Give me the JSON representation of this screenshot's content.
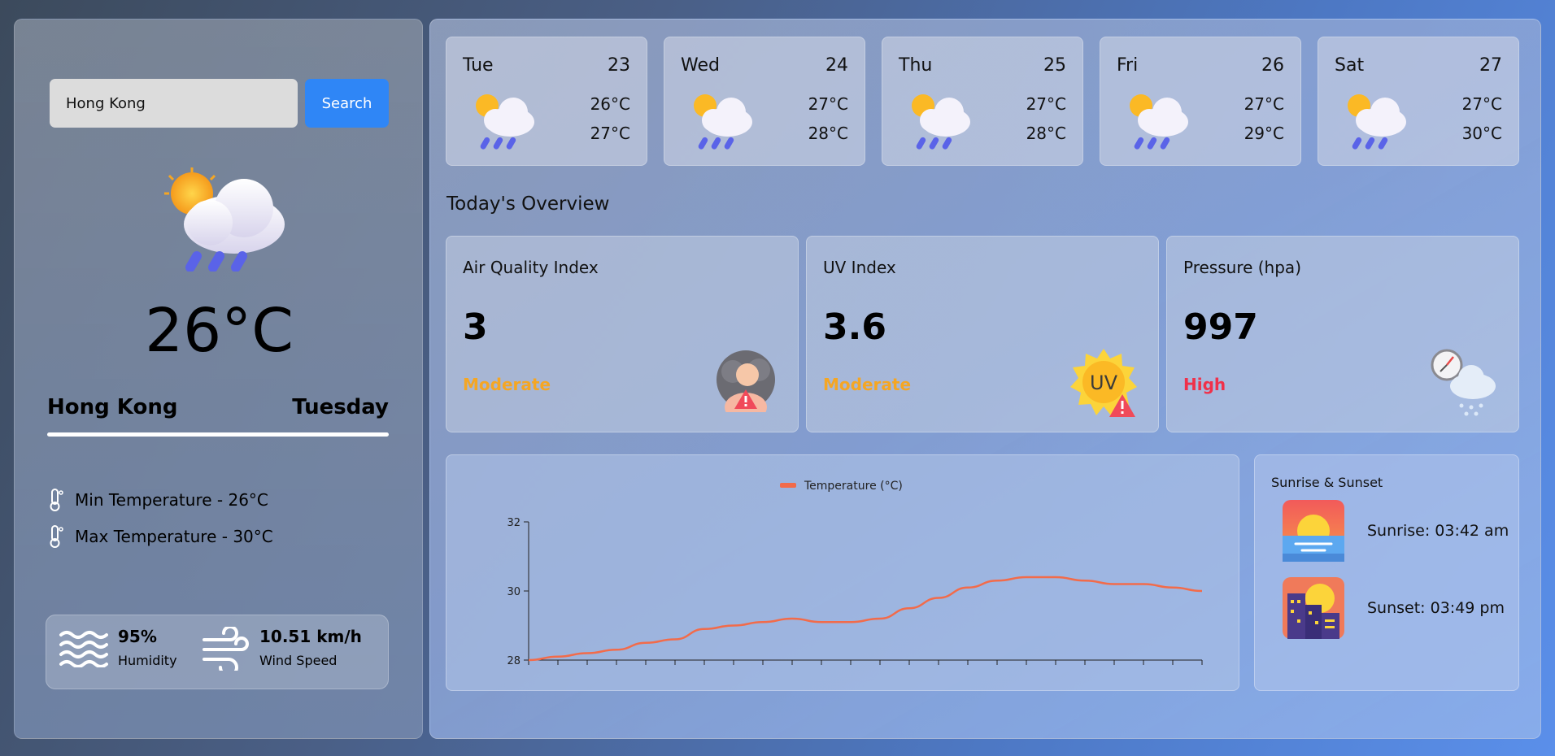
{
  "search": {
    "value": "Hong Kong",
    "button_label": "Search"
  },
  "current": {
    "temperature": "26°C",
    "location": "Hong Kong",
    "day": "Tuesday",
    "min_temp": "Min Temperature - 26°C",
    "max_temp": "Max Temperature - 30°C",
    "humidity_value": "95%",
    "humidity_label": "Humidity",
    "wind_value": "10.51 km/h",
    "wind_label": "Wind Speed",
    "icon": "sun-cloud-rain-icon"
  },
  "forecast": [
    {
      "day": "Tue",
      "date": "23",
      "min": "26°C",
      "max": "27°C"
    },
    {
      "day": "Wed",
      "date": "24",
      "min": "27°C",
      "max": "28°C"
    },
    {
      "day": "Thu",
      "date": "25",
      "min": "27°C",
      "max": "28°C"
    },
    {
      "day": "Fri",
      "date": "26",
      "min": "27°C",
      "max": "29°C"
    },
    {
      "day": "Sat",
      "date": "27",
      "min": "27°C",
      "max": "30°C"
    }
  ],
  "overview": {
    "title": "Today's Overview",
    "cards": [
      {
        "label": "Air Quality Index",
        "value": "3",
        "status": "Moderate",
        "status_color": "#f5a623",
        "icon": "air-quality-warning-icon"
      },
      {
        "label": "UV Index",
        "value": "3.6",
        "status": "Moderate",
        "status_color": "#f5a623",
        "icon": "uv-warning-icon"
      },
      {
        "label": "Pressure (hpa)",
        "value": "997",
        "status": "High",
        "status_color": "#f0304a",
        "icon": "barometer-cloud-icon"
      }
    ]
  },
  "chart_data": {
    "type": "line",
    "legend": [
      "Temperature (°C)"
    ],
    "series": [
      {
        "name": "Temperature (°C)",
        "color": "#f26b4a",
        "values": [
          28.0,
          28.1,
          28.2,
          28.3,
          28.5,
          28.6,
          28.9,
          29.0,
          29.1,
          29.2,
          29.1,
          29.1,
          29.2,
          29.5,
          29.8,
          30.1,
          30.3,
          30.4,
          30.4,
          30.3,
          30.2,
          30.2,
          30.1,
          30.0
        ]
      }
    ],
    "ylim": [
      28,
      32
    ],
    "yticks": [
      "28",
      "30",
      "32"
    ],
    "grid": false,
    "legend_position": "top-center"
  },
  "sun": {
    "title": "Sunrise & Sunset",
    "sunrise": "Sunrise: 03:42 am",
    "sunset": "Sunset: 03:49 pm"
  },
  "colors": {
    "accent": "#2f86f6",
    "moderate": "#f5a623",
    "high": "#f0304a",
    "line": "#f26b4a"
  }
}
